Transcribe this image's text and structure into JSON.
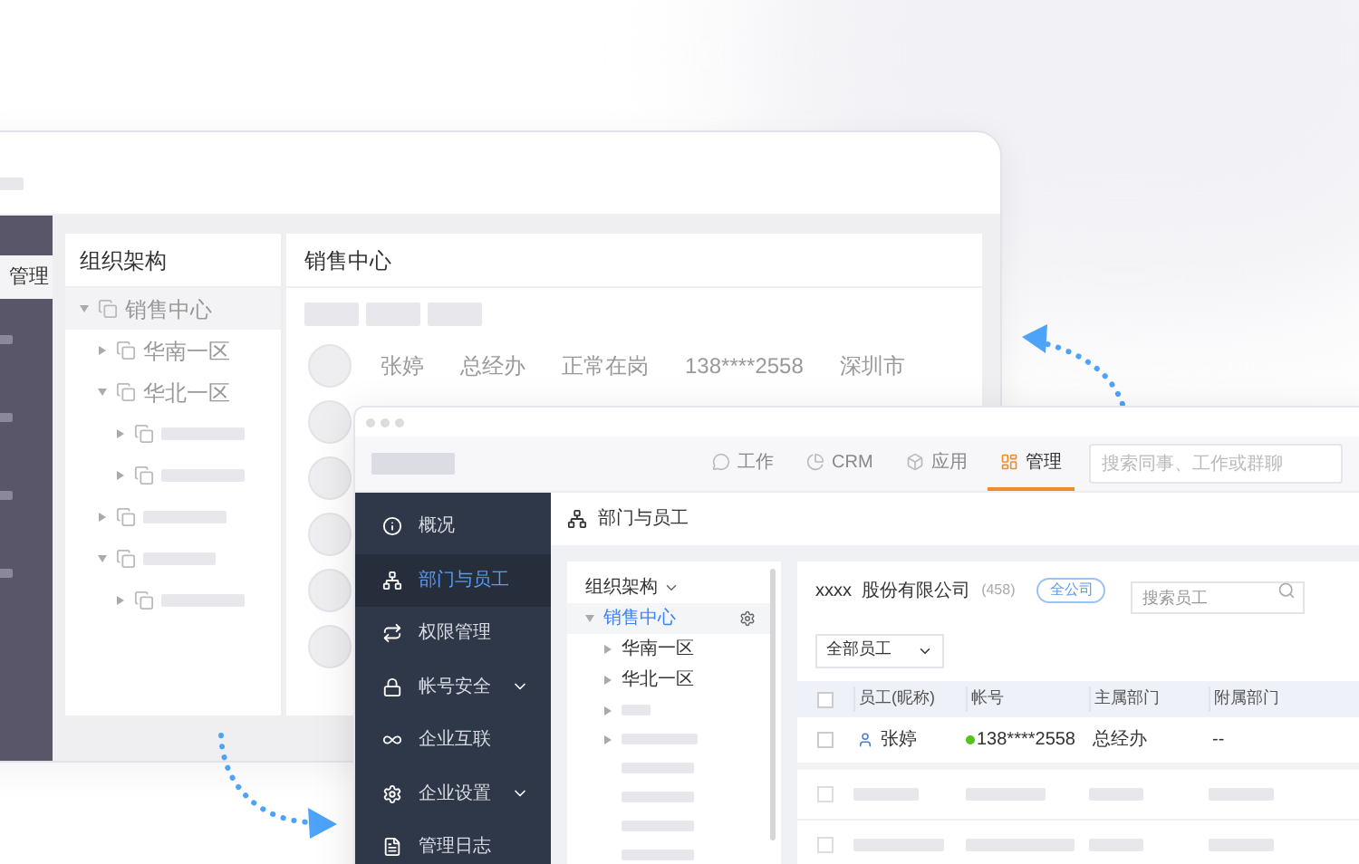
{
  "back_window": {
    "sidebar": {
      "items": [
        {
          "label": "管理",
          "selected": true
        }
      ]
    },
    "org_panel": {
      "title": "组织架构",
      "tree": [
        {
          "label": "销售中心",
          "expanded": true,
          "selected": true,
          "children": [
            {
              "label": "华南一区",
              "expanded": false,
              "selected": false
            },
            {
              "label": "华北一区",
              "expanded": true,
              "selected": false
            }
          ]
        }
      ]
    },
    "detail_panel": {
      "title": "销售中心",
      "rows": [
        {
          "name": "张婷",
          "department": "总经办",
          "status": "正常在岗",
          "phone": "138****2558",
          "city": "深圳市"
        }
      ]
    }
  },
  "front_window": {
    "tabs": [
      {
        "label": "工作",
        "kind": "work",
        "selected": false
      },
      {
        "label": "CRM",
        "kind": "crm",
        "selected": false
      },
      {
        "label": "应用",
        "kind": "apps",
        "selected": false
      },
      {
        "label": "管理",
        "kind": "admin",
        "selected": true
      }
    ],
    "search": {
      "placeholder": "搜索同事、工作或群聊"
    },
    "sidebar": {
      "items": [
        {
          "label": "概况",
          "kind": "info",
          "selected": false,
          "has_submenu": false
        },
        {
          "label": "部门与员工",
          "kind": "org",
          "selected": true,
          "has_submenu": false
        },
        {
          "label": "权限管理",
          "kind": "perm",
          "selected": false,
          "has_submenu": false
        },
        {
          "label": "帐号安全",
          "kind": "lock",
          "selected": false,
          "has_submenu": true
        },
        {
          "label": "企业互联",
          "kind": "link",
          "selected": false,
          "has_submenu": false
        },
        {
          "label": "企业设置",
          "kind": "gear",
          "selected": false,
          "has_submenu": true
        },
        {
          "label": "管理日志",
          "kind": "log",
          "selected": false,
          "has_submenu": false
        }
      ]
    },
    "page_title": "部门与员工",
    "org_panel": {
      "title": "组织架构",
      "tree": [
        {
          "label": "销售中心",
          "expanded": true,
          "selected": true,
          "children": [
            {
              "label": "华南一区",
              "expanded": false,
              "selected": false
            },
            {
              "label": "华北一区",
              "expanded": false,
              "selected": false
            }
          ]
        }
      ]
    },
    "company": {
      "name": "xxxx  股份有限公司",
      "count": "(458)",
      "badge": "全公司"
    },
    "employee_search": {
      "placeholder": "搜索员工"
    },
    "filter": {
      "value": "全部员工"
    },
    "table": {
      "select_all": {
        "checked": false
      },
      "placeholder_rows": [
        {
          "checked": false
        },
        {
          "checked": false
        }
      ],
      "columns": [
        "员工(昵称)",
        "帐号",
        "主属部门",
        "附属部门"
      ],
      "rows": [
        {
          "checked": false,
          "online": true,
          "cells": [
            "张婷",
            "138****2558",
            "总经办",
            "--"
          ]
        }
      ]
    }
  }
}
